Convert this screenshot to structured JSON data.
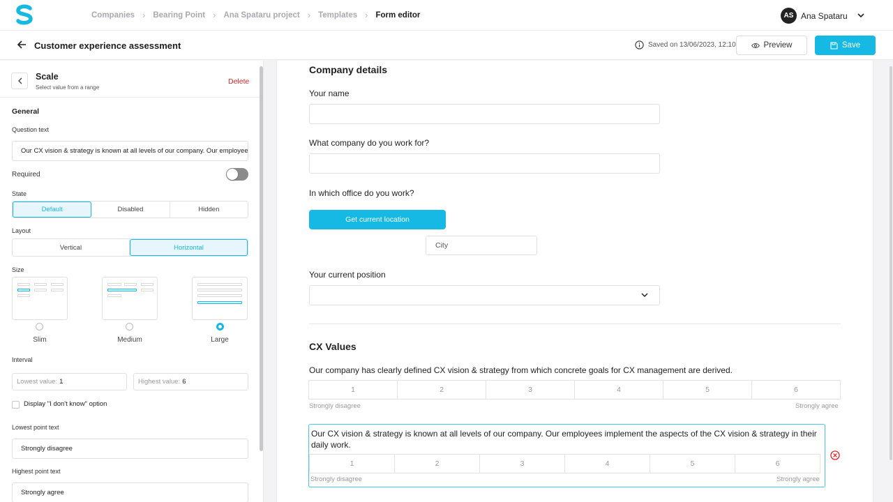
{
  "topbar": {
    "logo_icon": "s-logo-icon",
    "breadcrumbs": [
      "Companies",
      "Bearing Point",
      "Ana Spataru project",
      "Templates",
      "Form editor"
    ],
    "user": {
      "initials": "AS",
      "name": "Ana Spataru"
    }
  },
  "header": {
    "title": "Customer experience assessment",
    "saved": "Saved on 13/06/2023, 12:10",
    "preview_label": "Preview",
    "save_label": "Save"
  },
  "panel": {
    "title": "Scale",
    "subtitle": "Select value from a range",
    "delete_label": "Delete",
    "general_heading": "General",
    "question_text_label": "Question text",
    "question_text_value": "Our CX vision & strategy is known at all levels of our company. Our employees implement the aspects of the CX vision & strategy in their daily work.",
    "required_label": "Required",
    "required_on": false,
    "state_label": "State",
    "state_options": [
      "Default",
      "Disabled",
      "Hidden"
    ],
    "state_selected": "Default",
    "layout_label": "Layout",
    "layout_options": [
      "Vertical",
      "Horizontal"
    ],
    "layout_selected": "Horizontal",
    "size_label": "Size",
    "size_options": [
      "Slim",
      "Medium",
      "Large"
    ],
    "size_selected": "Large",
    "interval_label": "Interval",
    "lowest_label": "Lowest value:",
    "lowest_value": "1",
    "highest_label": "Highest value:",
    "highest_value": "6",
    "dont_know_label": "Display \"I don't know\" option",
    "dont_know_checked": false,
    "lowest_point_label": "Lowest point text",
    "lowest_point_value": "Strongly disagree",
    "highest_point_label": "Highest point text",
    "highest_point_value": "Strongly agree"
  },
  "form": {
    "section1_title": "Company details",
    "q_name": "Your name",
    "q_company": "What company do you work for?",
    "q_office": "In which office do you work?",
    "location_button": "Get current location",
    "city_placeholder": "City",
    "q_position": "Your current position",
    "section2_title": "CX Values",
    "q_cx1": "Our company has clearly defined CX vision & strategy from which concrete goals for CX management are derived.",
    "q_cx2": "Our CX vision & strategy is known at all levels of our company. Our employees implement the aspects of the CX vision & strategy in their daily work.",
    "scale_values": [
      "1",
      "2",
      "3",
      "4",
      "5",
      "6"
    ],
    "scale_low": "Strongly disagree",
    "scale_high": "Strongly agree"
  },
  "colors": {
    "accent": "#16b9e3",
    "danger": "#e02424"
  }
}
